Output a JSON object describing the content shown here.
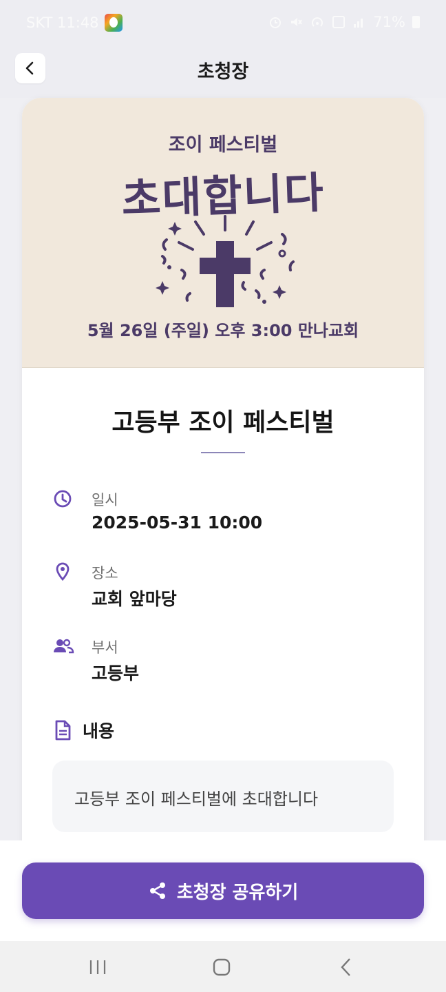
{
  "status_bar": {
    "carrier_time": "SKT 11:48",
    "battery": "71%",
    "icons": [
      "alarm-icon",
      "mute-icon",
      "hotspot-icon",
      "data-icon",
      "signal-icon",
      "battery-icon"
    ]
  },
  "app_bar": {
    "title": "초청장",
    "back_icon": "chevron-left-icon"
  },
  "banner": {
    "subtitle": "조이 페스티벌",
    "title": "초대합니다",
    "date_line": "5월 26일 (주일) 오후 3:00   만나교회",
    "art_icon": "cross-icon",
    "colors": {
      "background": "#f1e8dc",
      "ink": "#4b3a67"
    }
  },
  "event": {
    "title": "고등부 조이 페스티벌"
  },
  "info": [
    {
      "icon": "clock-icon",
      "label": "일시",
      "value": "2025-05-31 10:00"
    },
    {
      "icon": "location-pin-icon",
      "label": "장소",
      "value": "교회 앞마당"
    },
    {
      "icon": "people-icon",
      "label": "부서",
      "value": "고등부"
    }
  ],
  "content": {
    "icon": "document-icon",
    "label": "내용",
    "text": "고등부 조이 페스티벌에 초대합니다"
  },
  "share_button": {
    "icon": "share-icon",
    "label": "초청장 공유하기",
    "color": "#6a4bb5"
  },
  "nav_bar": {
    "icons": [
      "recent-apps-icon",
      "home-icon",
      "back-icon"
    ]
  },
  "colors": {
    "accent": "#6a4bb5",
    "icon_purple": "#6a4bb5"
  }
}
